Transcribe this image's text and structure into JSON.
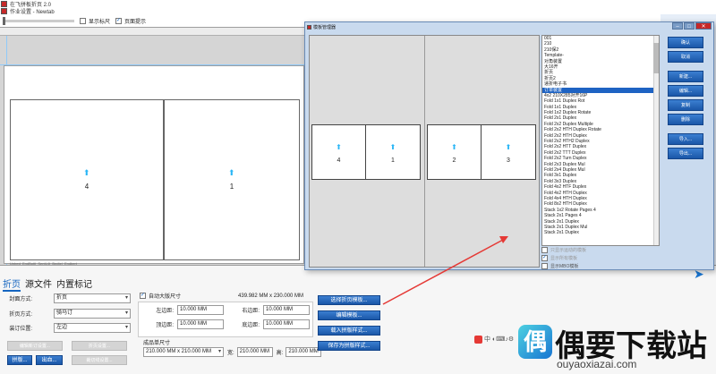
{
  "titlebar": {
    "title": "在飞拼板折页 2.0",
    "subtitle": "作业设置 - Newtab"
  },
  "toolbar": {
    "show_ruler": "显示标尺",
    "page_hint": "页面提示"
  },
  "sheet": {
    "pages": [
      "4",
      "1"
    ],
    "strip": "Unbed_EndBottl_SentL4t_Bndtel_Endbert"
  },
  "right_buttons": [
    "确认",
    "取消",
    "新建...",
    "编辑...",
    "复制",
    "删除",
    "导入...",
    "导出..."
  ],
  "dialog": {
    "title": "模板管理器",
    "preview_left": [
      "4",
      "1"
    ],
    "preview_right": [
      "2",
      "3"
    ],
    "list": [
      "001",
      "210",
      "210保2",
      "Template-",
      "对角装置",
      "大16开",
      "折页",
      "折页2",
      "递折电子书",
      "订单装置",
      "4x2 210X285对开16P",
      "Fold 1x1 Duplex Rot",
      "Fold 1x1 Duplex",
      "Fold 1x2 Duplex Rotate",
      "Fold 2x1 Duplex",
      "Fold 2x2 Duplex Multiple",
      "Fold 2x2 HTH Duplex Rotate",
      "Fold 2x2 HTH Duplex",
      "Fold 2x2 HTH2 Duplex",
      "Fold 2x2 HTT Duplex",
      "Fold 2x2 TTT Duplex",
      "Fold 2x2 Turn Duplex",
      "Fold 2x3 Duplex Mul",
      "Fold 2x4 Duplex Mul",
      "Fold 3x1 Duplex",
      "Fold 3x3 Duplex",
      "Fold 4x2 HTF Duplex",
      "Fold 4x2 HTH Duplex",
      "Fold 4x4 HTH Duplex",
      "Fold 8x2 HTH Duplex",
      "Stack 1x2 Rotate Pages 4",
      "Stack 2x1 Pages 4",
      "Stack 2x1 Duplex",
      "Stack 2x1 Duplex Mul",
      "Stack 2x1 Duplex"
    ],
    "selected_index": 9,
    "checks": [
      "只显示运动的模板",
      "显示所有模板",
      "显示MBO模板"
    ],
    "buttons": [
      "确认",
      "取消",
      "新建...",
      "编辑...",
      "复制",
      "删除",
      "导入...",
      "导出..."
    ]
  },
  "bottom": {
    "tabs": [
      "折页",
      "源文件",
      "内置标记"
    ],
    "fields": [
      {
        "label": "封面方式:",
        "value": "折页"
      },
      {
        "label": "折页方式:",
        "value": "骑马订"
      },
      {
        "label": "装订位置:",
        "value": "左边"
      }
    ],
    "auto_size_label": "自动大版尺寸",
    "sheet_size": "439.982 MM x 230.000 MM",
    "margins": [
      {
        "label": "左边距:",
        "value": "10.000 MM"
      },
      {
        "label": "右边距:",
        "value": "10.000 MM"
      },
      {
        "label": "顶边距:",
        "value": "10.000 MM"
      },
      {
        "label": "底边距:",
        "value": "10.000 MM"
      }
    ],
    "finished_label": "成品单尺寸",
    "finished_size": "210.000 MM x 210.000 MM",
    "width_label": "宽:",
    "width_value": "210.000 MM",
    "height_label": "高:",
    "height_value": "210.000 MM",
    "action_buttons": [
      "选择折页模板...",
      "编辑模板...",
      "载入拼版样式...",
      "保存为拼版样式..."
    ],
    "gray_buttons": [
      "编辑新订设置...",
      "折页设置...",
      "裁切线设置..."
    ],
    "small_blue": [
      "拼版...",
      "出血..."
    ],
    "brand_text": "中"
  },
  "watermark": {
    "title": "偶要下载站",
    "url": "ouyaoxiazai.com",
    "logo": "偶"
  }
}
